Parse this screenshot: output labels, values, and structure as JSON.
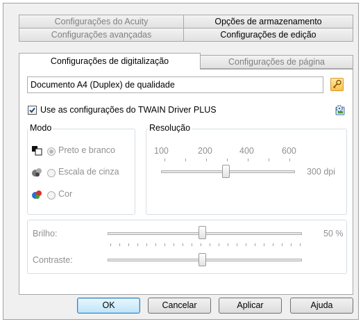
{
  "tabs": {
    "row1": [
      "Configurações do Acuity",
      "Opções de armazenamento"
    ],
    "row2": [
      "Configurações avançadas",
      "Configurações de edição"
    ],
    "row3": [
      "Configurações de digitalização",
      "Configurações de página"
    ]
  },
  "profile": {
    "value": "Documento A4 (Duplex) de qualidade"
  },
  "twain_checkbox": {
    "label": "Use as configurações do TWAIN Driver PLUS",
    "checked": true
  },
  "mode": {
    "title": "Modo",
    "options": [
      "Preto e branco",
      "Escala de cinza",
      "Cor"
    ],
    "selected": "Preto e branco"
  },
  "resolution": {
    "title": "Resolução",
    "ticks": [
      "100",
      "200",
      "400",
      "600"
    ],
    "value_label": "300 dpi",
    "value": 300
  },
  "brightness": {
    "label": "Brilho:",
    "value_label": "50 %",
    "value": 50
  },
  "contrast": {
    "label": "Contraste:",
    "value": 50
  },
  "buttons": {
    "ok": "OK",
    "cancel": "Cancelar",
    "apply": "Aplicar",
    "help": "Ajuda"
  }
}
